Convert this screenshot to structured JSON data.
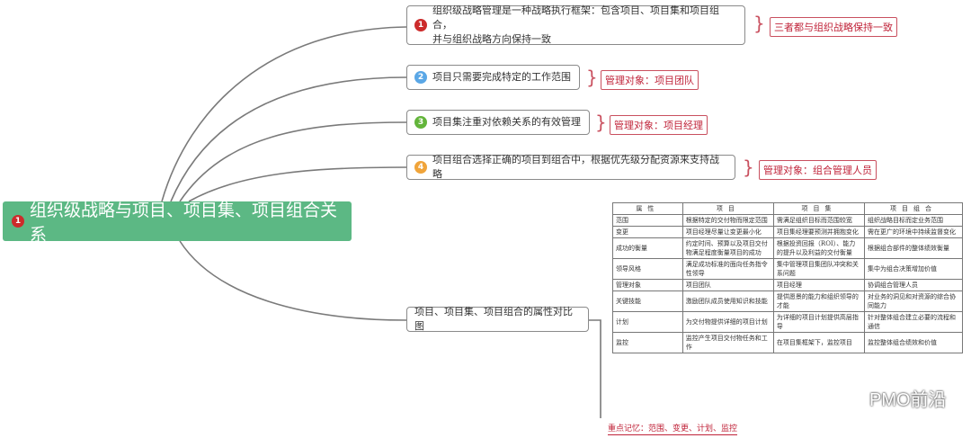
{
  "root": {
    "num": "1",
    "label": "组织级战略与项目、项目集、项目组合关系"
  },
  "branches": [
    {
      "num": "1",
      "text_line1": "组织级战略管理是一种战略执行框架：包含项目、项目集和项目组合，",
      "text_line2": "并与组织战略方向保持一致",
      "tag": "三者都与组织战略保持一致"
    },
    {
      "num": "2",
      "text": "项目只需要完成特定的工作范围",
      "tag": "管理对象：项目团队"
    },
    {
      "num": "3",
      "text": "项目集注重对依赖关系的有效管理",
      "tag": "管理对象：项目经理"
    },
    {
      "num": "4",
      "text": "项目组合选择正确的项目到组合中，根据优先级分配资源来支持战略",
      "tag": "管理对象：组合管理人员"
    }
  ],
  "compare_node": {
    "label": "项目、项目集、项目组合的属性对比图"
  },
  "table": {
    "headers": [
      "属性",
      "项目",
      "项目集",
      "项目组合"
    ],
    "rows": [
      [
        "范围",
        "根据特定的交付物而限定范围",
        "需满足组织目标而范围较宽",
        "组织战略目标而定业务范围"
      ],
      [
        "变更",
        "项目经理尽量让变更最小化",
        "项目集经理要预测并拥抱变化",
        "需在更广的环境中持续监督变化"
      ],
      [
        "成功的衡量",
        "约定时间、预算以及项目交付物满足程度衡量项目的成功",
        "根据投资回报（ROI）、能力的提升以及利益的交付衡量",
        "根据组合部件的整体绩效衡量"
      ],
      [
        "领导风格",
        "满足成功标准的面向任务指令性领导",
        "集中管理项目集团队冲突和关系问题",
        "集中为组合决策增加价值"
      ],
      [
        "管理对象",
        "项目团队",
        "项目经理",
        "协调组合管理人员"
      ],
      [
        "关键技能",
        "激励团队成员使用知识和技能",
        "提供愿景的能力和组织领导的才能",
        "对业务的洞见和对资源的综合协同能力"
      ],
      [
        "计划",
        "为交付物提供详细的项目计划",
        "为详细的项目计划提供高层指导",
        "针对整体组合建立必要的流程和通信"
      ],
      [
        "监控",
        "监控产生项目交付物任务和工作",
        "在项目集框架下，监控项目",
        "监控整体组合绩效和价值"
      ]
    ]
  },
  "watermark": {
    "text": "PMO前沿",
    "icon": "wechat-icon"
  },
  "memo": "重点记忆：范围、变更、计划、监控",
  "colors": {
    "root": "#5cb884",
    "badge1": "#cc2b2b",
    "badge2": "#5aa7e6",
    "badge3": "#63b53b",
    "badge4": "#f0a43a",
    "tag": "#c0243a"
  }
}
